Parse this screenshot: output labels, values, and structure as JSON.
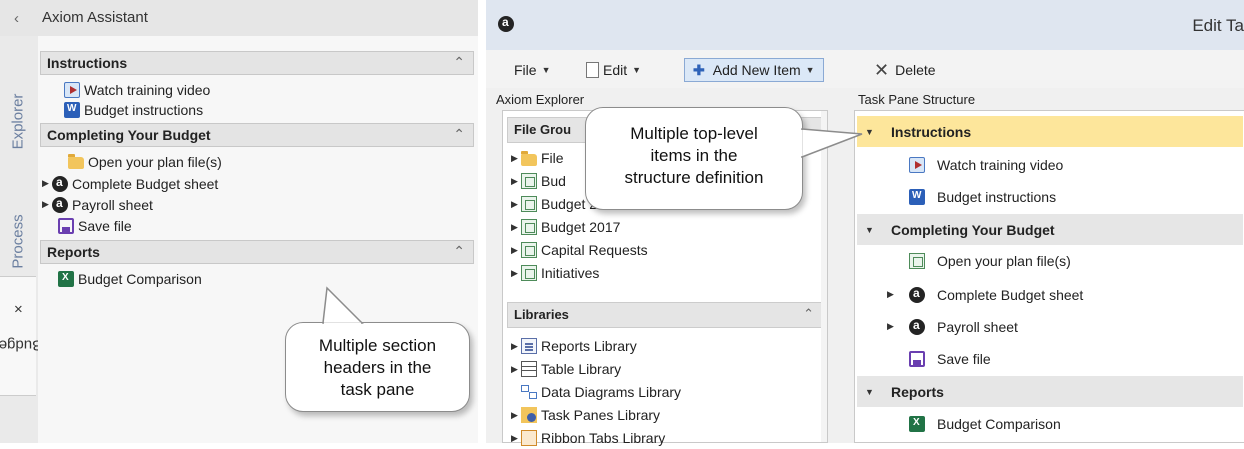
{
  "left_pane": {
    "title": "Axiom Assistant",
    "vertical_tabs": [
      {
        "label": "Explorer"
      },
      {
        "label": "Process"
      },
      {
        "label": "Budget"
      }
    ],
    "budget_tab_close": "×",
    "sections": [
      {
        "label": "Instructions",
        "items": [
          "Watch training video",
          "Budget instructions"
        ]
      },
      {
        "label": "Completing Your Budget",
        "items": [
          "Open your plan file(s)",
          "Complete Budget sheet",
          "Payroll sheet",
          "Save file"
        ]
      },
      {
        "label": "Reports",
        "items": [
          "Budget Comparison"
        ]
      }
    ],
    "callout": [
      "Multiple section",
      "headers in the",
      "task pane"
    ]
  },
  "editor": {
    "title": "Edit Ta",
    "toolbar": {
      "file": "File",
      "edit": "Edit",
      "add_new_item": "Add New Item",
      "delete": "Delete"
    },
    "explorer_label": "Axiom Explorer",
    "explorer_sections": [
      {
        "label": "File Grou",
        "items": [
          "File",
          "Bud",
          "Budget 2016",
          "Budget 2017",
          "Capital Requests",
          "Initiatives"
        ]
      },
      {
        "label": "Libraries",
        "items": [
          "Reports Library",
          "Table Library",
          "Data Diagrams Library",
          "Task Panes Library",
          "Ribbon Tabs Library"
        ]
      }
    ],
    "structure_label": "Task Pane Structure",
    "structure": {
      "instructions": "Instructions",
      "watch": "Watch training video",
      "budget_instr": "Budget instructions",
      "completing": "Completing Your Budget",
      "open_plan": "Open your plan file(s)",
      "complete_sheet": "Complete Budget sheet",
      "payroll": "Payroll sheet",
      "save": "Save file",
      "reports": "Reports",
      "comparison": "Budget Comparison"
    },
    "callout": [
      "Multiple top-level",
      "items in the",
      "structure definition"
    ]
  },
  "colors": {
    "selected_row": "#fde69b",
    "header_row": "#e6e6e6",
    "add_button": "#dbe8f7",
    "title_bar": "#dfe6f0"
  },
  "icons": [
    "chevron-left-icon",
    "video-icon",
    "word-doc-icon",
    "folder-icon",
    "axiom-logo-icon",
    "save-icon",
    "excel-icon",
    "grid-file-icon",
    "report-icon",
    "table-icon",
    "diagram-icon",
    "task-pane-icon",
    "ribbon-icon",
    "delete-x-icon",
    "plus-icon"
  ]
}
